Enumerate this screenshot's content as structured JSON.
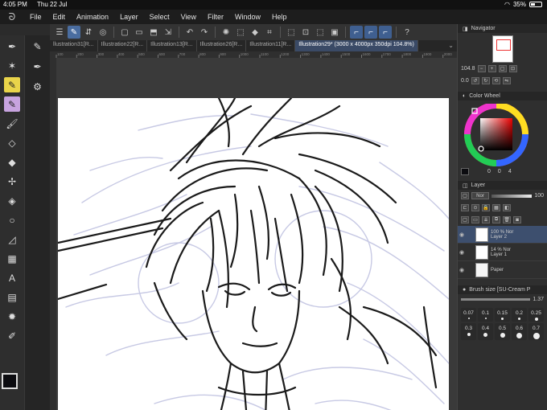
{
  "status": {
    "time": "4:05 PM",
    "date": "Thu 22 Jul",
    "battery": "35%"
  },
  "menu": [
    "File",
    "Edit",
    "Animation",
    "Layer",
    "Select",
    "View",
    "Filter",
    "Window",
    "Help"
  ],
  "tabs": [
    {
      "label": "llustration31[R..."
    },
    {
      "label": "Illustration22[R..."
    },
    {
      "label": "Illustration13[R..."
    },
    {
      "label": "Illustration26[R..."
    },
    {
      "label": "Illustration11[R..."
    },
    {
      "label": "Illustration29* (3000 x 4000px 350dpi 104.8%)"
    }
  ],
  "ruler": {
    "ticks": [
      "100",
      "200",
      "300",
      "400",
      "500",
      "600",
      "700",
      "800",
      "900",
      "1000",
      "1100",
      "1200",
      "1300",
      "1400",
      "1500",
      "1600",
      "1700",
      "1800",
      "1900",
      "2000"
    ]
  },
  "navigator": {
    "title": "Navigator",
    "zoom": "104.8",
    "angle": "0.0"
  },
  "color_wheel": {
    "title": "Color Wheel",
    "values": [
      "0",
      "0",
      "4"
    ],
    "main_color": "#0c0c10",
    "sub_color": "#d8c58d"
  },
  "layer_panel": {
    "title": "Layer",
    "blend": "Nor",
    "opacity": "100",
    "layers": [
      {
        "percent": "100 %",
        "mode": "Nor",
        "name": "Layer 2",
        "selected": true
      },
      {
        "percent": "14 %",
        "mode": "Nor",
        "name": "Layer 1",
        "selected": false
      },
      {
        "percent": "",
        "mode": "",
        "name": "Paper",
        "selected": false
      }
    ]
  },
  "brush": {
    "label": "Brush size [SU-Cream P",
    "value": "1.37",
    "sizes": [
      "0.07",
      "0.1",
      "0.15",
      "0.2",
      "0.25",
      "0.3",
      "0.4",
      "0.5",
      "0.6",
      "0.7"
    ]
  }
}
